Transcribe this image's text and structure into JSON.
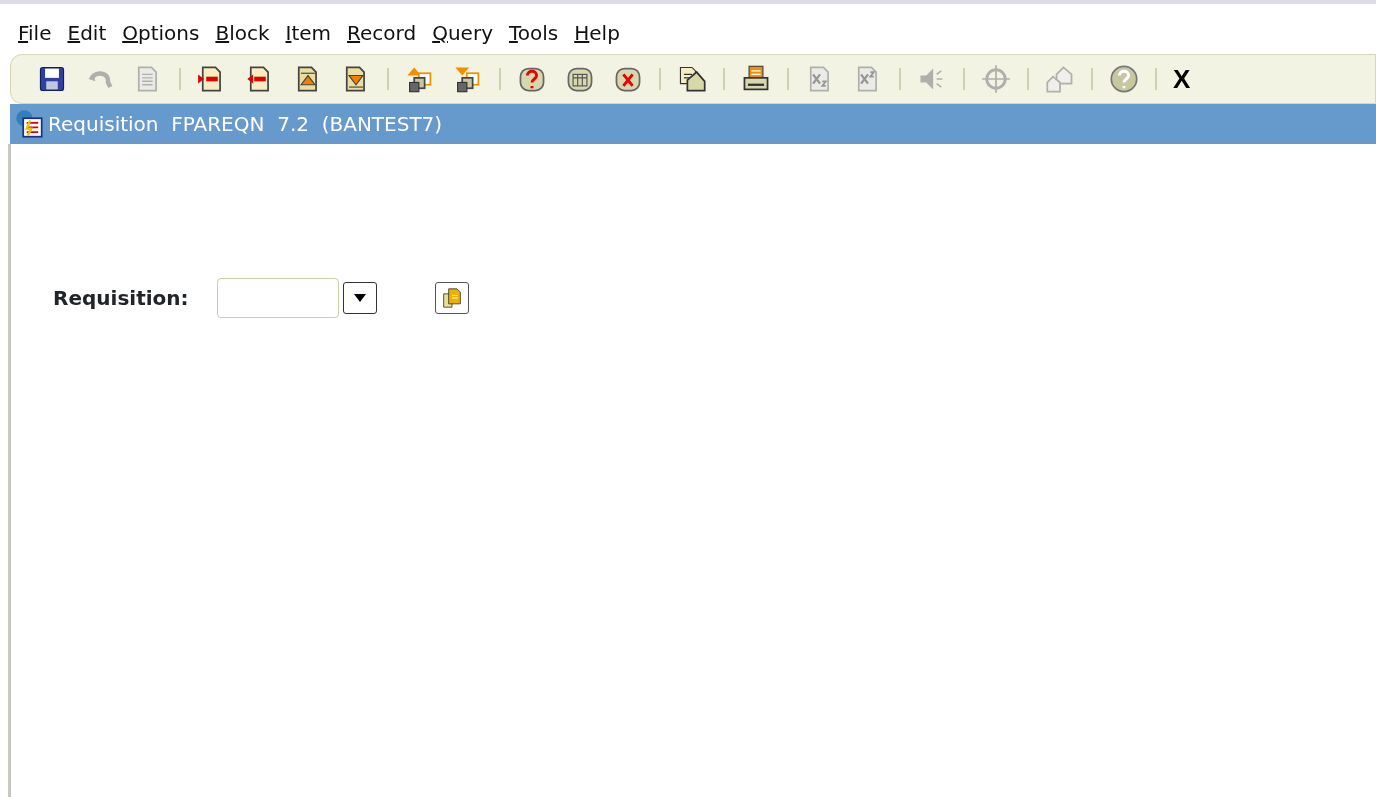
{
  "menu": [
    {
      "label": "File"
    },
    {
      "label": "Edit"
    },
    {
      "label": "Options"
    },
    {
      "label": "Block"
    },
    {
      "label": "Item"
    },
    {
      "label": "Record"
    },
    {
      "label": "Query"
    },
    {
      "label": "Tools"
    },
    {
      "label": "Help"
    }
  ],
  "toolbar": [
    [
      {
        "kind": "save",
        "disabled": false
      },
      {
        "kind": "undo",
        "disabled": true
      },
      {
        "kind": "page",
        "disabled": true
      }
    ],
    [
      {
        "kind": "next",
        "disabled": false
      },
      {
        "kind": "prev",
        "disabled": false
      },
      {
        "kind": "up",
        "disabled": false
      },
      {
        "kind": "down",
        "disabled": false
      }
    ],
    [
      {
        "kind": "stackup",
        "disabled": false
      },
      {
        "kind": "stackdown",
        "disabled": false
      }
    ],
    [
      {
        "kind": "dbquery",
        "disabled": false
      },
      {
        "kind": "dbtable",
        "disabled": false
      },
      {
        "kind": "dbcancel",
        "disabled": false
      }
    ],
    [
      {
        "kind": "mail",
        "disabled": false
      }
    ],
    [
      {
        "kind": "print",
        "disabled": false
      }
    ],
    [
      {
        "kind": "xs",
        "disabled": true
      },
      {
        "kind": "xs2",
        "disabled": true
      }
    ],
    [
      {
        "kind": "speaker",
        "disabled": true
      }
    ],
    [
      {
        "kind": "target",
        "disabled": true
      }
    ],
    [
      {
        "kind": "houses",
        "disabled": true
      }
    ],
    [
      {
        "kind": "help",
        "disabled": false
      }
    ],
    [
      {
        "kind": "text",
        "label": "X",
        "disabled": false
      }
    ]
  ],
  "window": {
    "title": "Requisition  FPAREQN  7.2  (BANTEST7)"
  },
  "form": {
    "label": "Requisition:"
  }
}
